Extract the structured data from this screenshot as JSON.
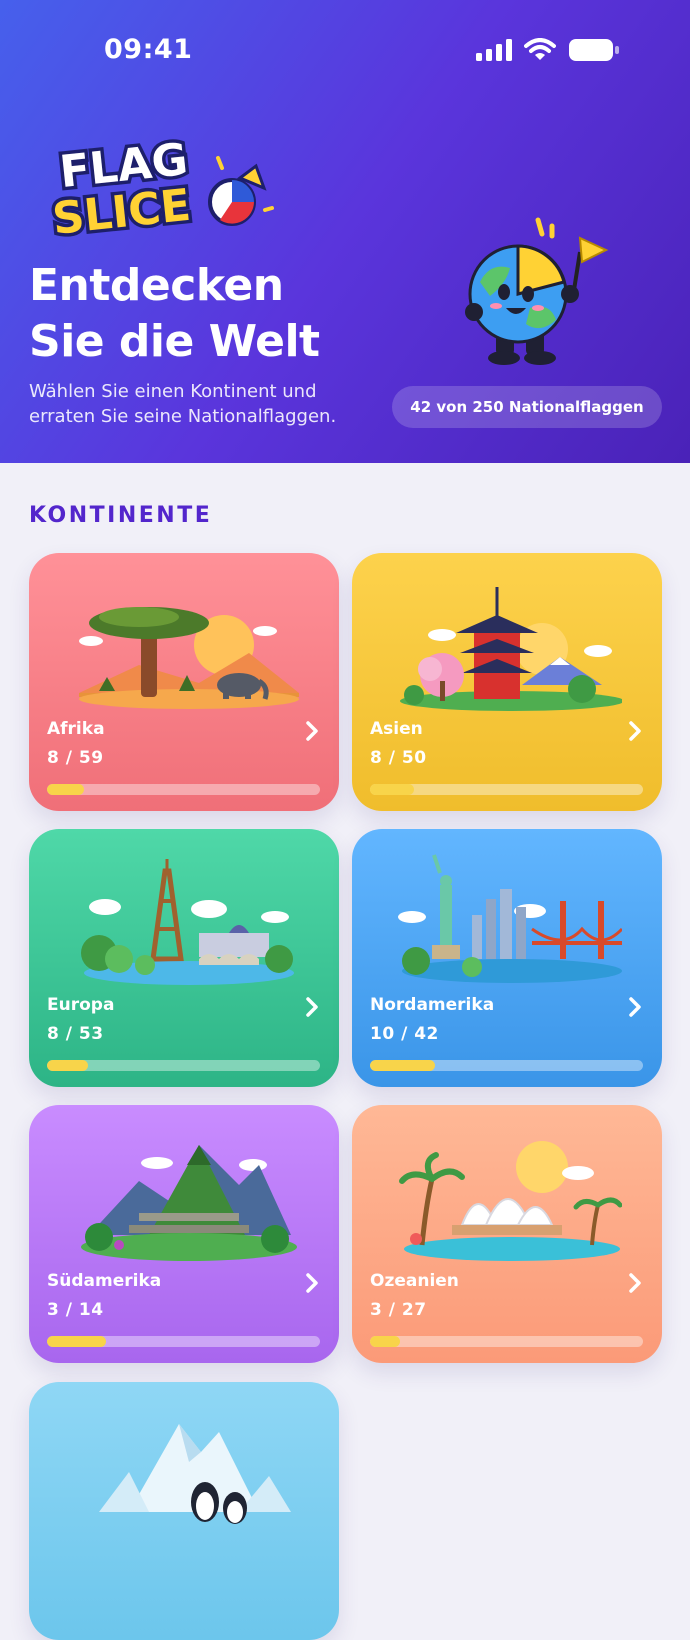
{
  "status_bar": {
    "time": "09:41"
  },
  "header": {
    "logo_line1": "FLAG",
    "logo_line2": "SLICE",
    "title_line1": "Entdecken",
    "title_line2": "Sie die Welt",
    "subtitle_line1": "Wählen Sie einen Kontinent und",
    "subtitle_line2": "erraten Sie seine Nationalflaggen.",
    "progress_label": "42 von 250 Nationalflaggen"
  },
  "section_title": "KONTINENTE",
  "colors": {
    "accent": "#5326cc",
    "progress_fill": "#f8d44a",
    "header_start": "#4660ec",
    "header_end": "#4a22b8"
  },
  "continents": [
    {
      "name": "Afrika",
      "progress": "8 / 59",
      "solved": 8,
      "total": 59,
      "color": "#f47a82",
      "icon": "chevron-right-icon"
    },
    {
      "name": "Asien",
      "progress": "8 / 50",
      "solved": 8,
      "total": 50,
      "color": "#f5c535",
      "icon": "chevron-right-icon"
    },
    {
      "name": "Europa",
      "progress": "8 / 53",
      "solved": 8,
      "total": 53,
      "color": "#36c290",
      "icon": "chevron-right-icon"
    },
    {
      "name": "Nordamerika",
      "progress": "10 / 42",
      "solved": 10,
      "total": 42,
      "color": "#4aa4f0",
      "icon": "chevron-right-icon"
    },
    {
      "name": "Südamerika",
      "progress": "3 / 14",
      "solved": 3,
      "total": 14,
      "color": "#b575f3",
      "icon": "chevron-right-icon"
    },
    {
      "name": "Ozeanien",
      "progress": "3 / 27",
      "solved": 3,
      "total": 27,
      "color": "#fca582",
      "icon": "chevron-right-icon"
    },
    {
      "name": "",
      "progress": "",
      "color": "#7ccdf0"
    }
  ]
}
